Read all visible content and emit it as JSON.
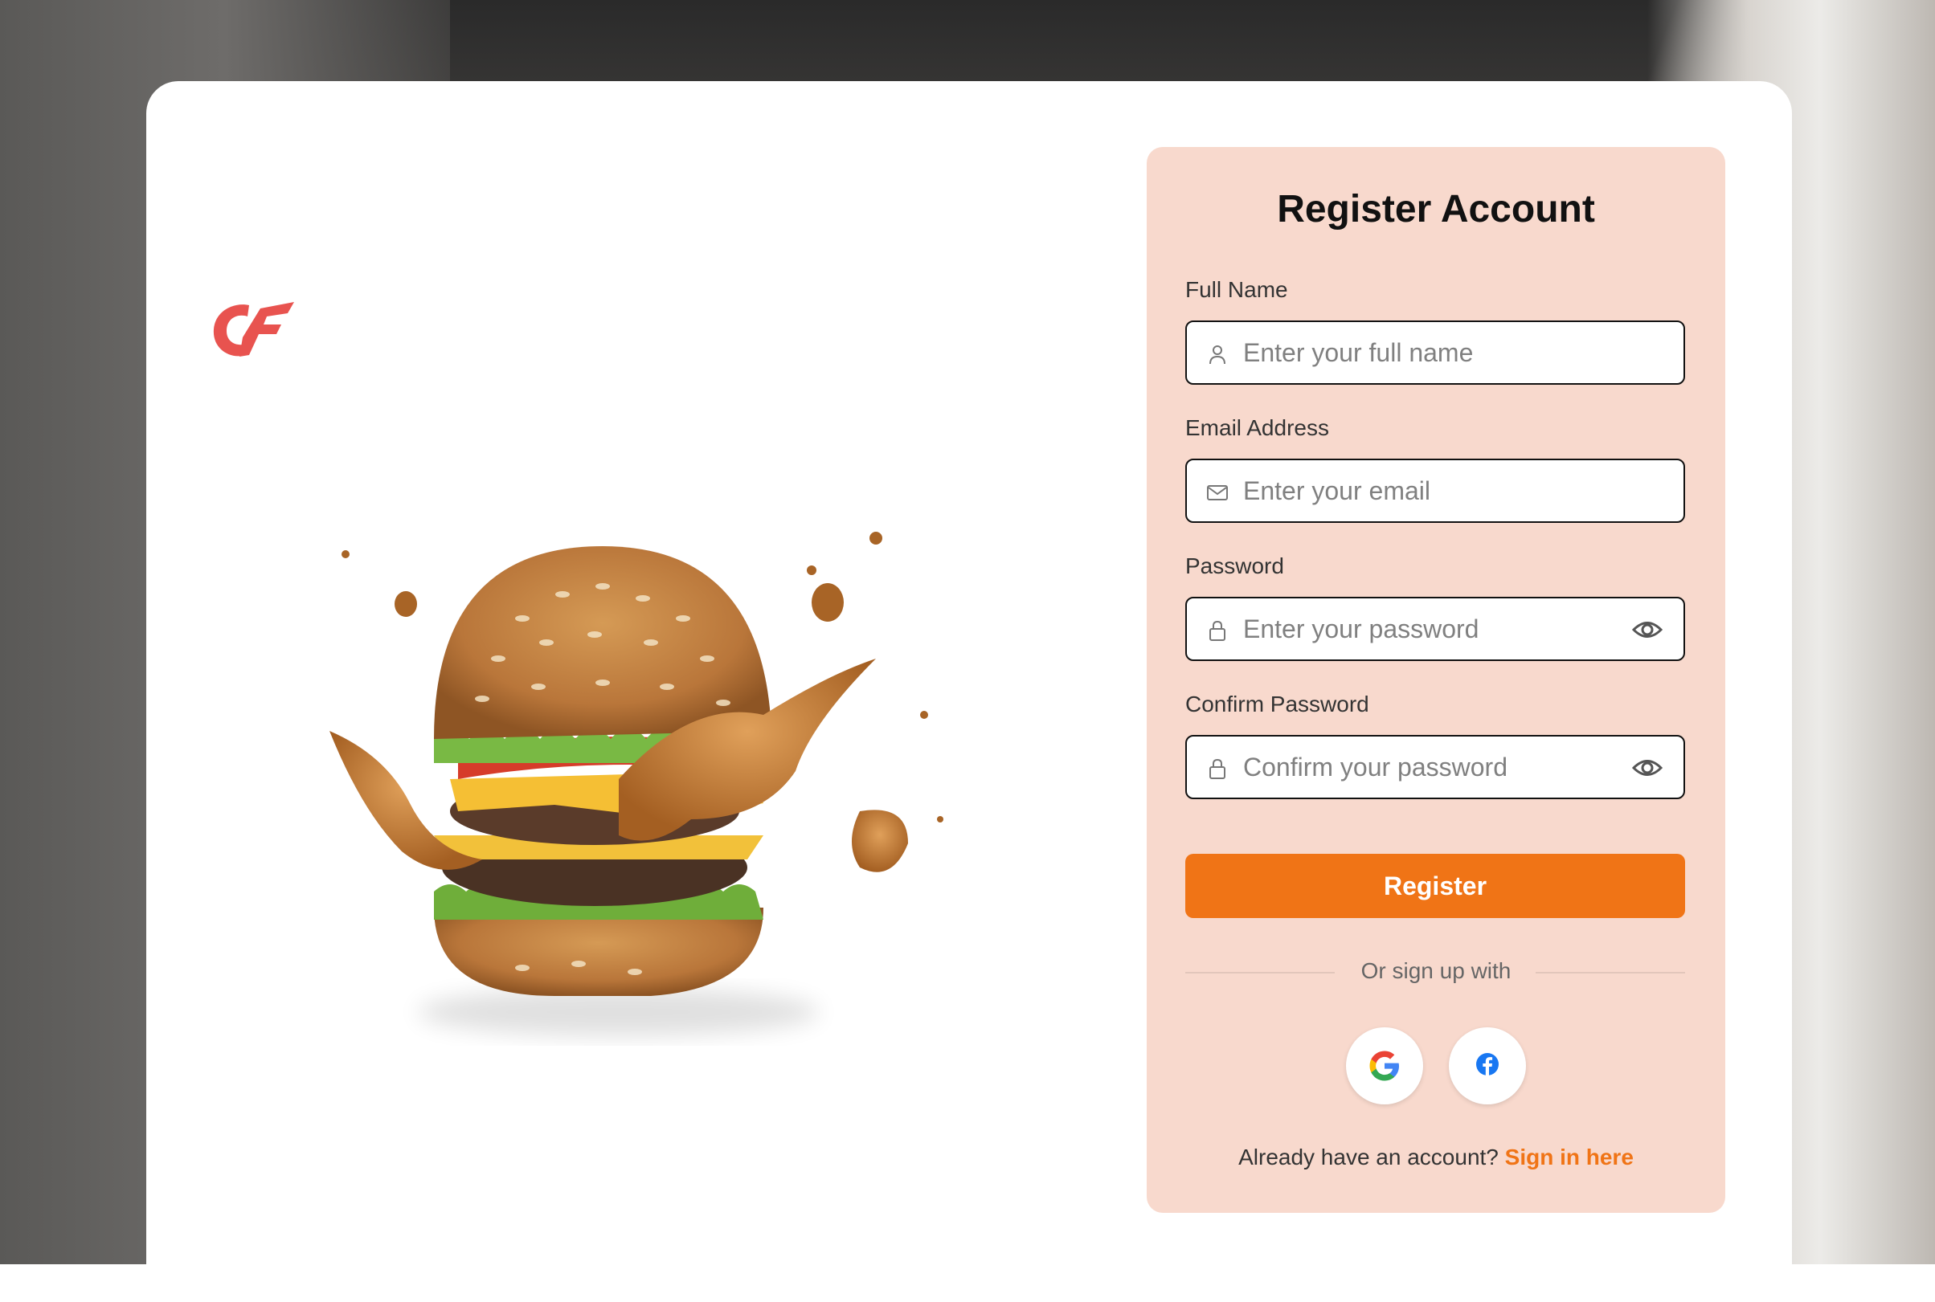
{
  "form": {
    "title": "Register Account",
    "fields": [
      {
        "label": "Full Name",
        "placeholder": "Enter your full name",
        "icon": "user-icon"
      },
      {
        "label": "Email Address",
        "placeholder": "Enter your email",
        "icon": "mail-icon"
      },
      {
        "label": "Password",
        "placeholder": "Enter your password",
        "icon": "lock-icon",
        "toggle_icon": "eye-icon"
      },
      {
        "label": "Confirm Password",
        "placeholder": "Confirm your password",
        "icon": "lock-icon",
        "toggle_icon": "eye-icon"
      }
    ],
    "register_label": "Register",
    "divider_text": "Or sign up with",
    "social": [
      "google-icon",
      "facebook-icon"
    ],
    "footer_text": "Already have an account?",
    "footer_link": "Sign in here"
  },
  "brand": {
    "logo_icon": "brand-logo-icon",
    "image": "burger-illustration"
  },
  "colors": {
    "accent": "#f07416",
    "panel": "#f8d9cd",
    "logo": "#e8534f"
  }
}
